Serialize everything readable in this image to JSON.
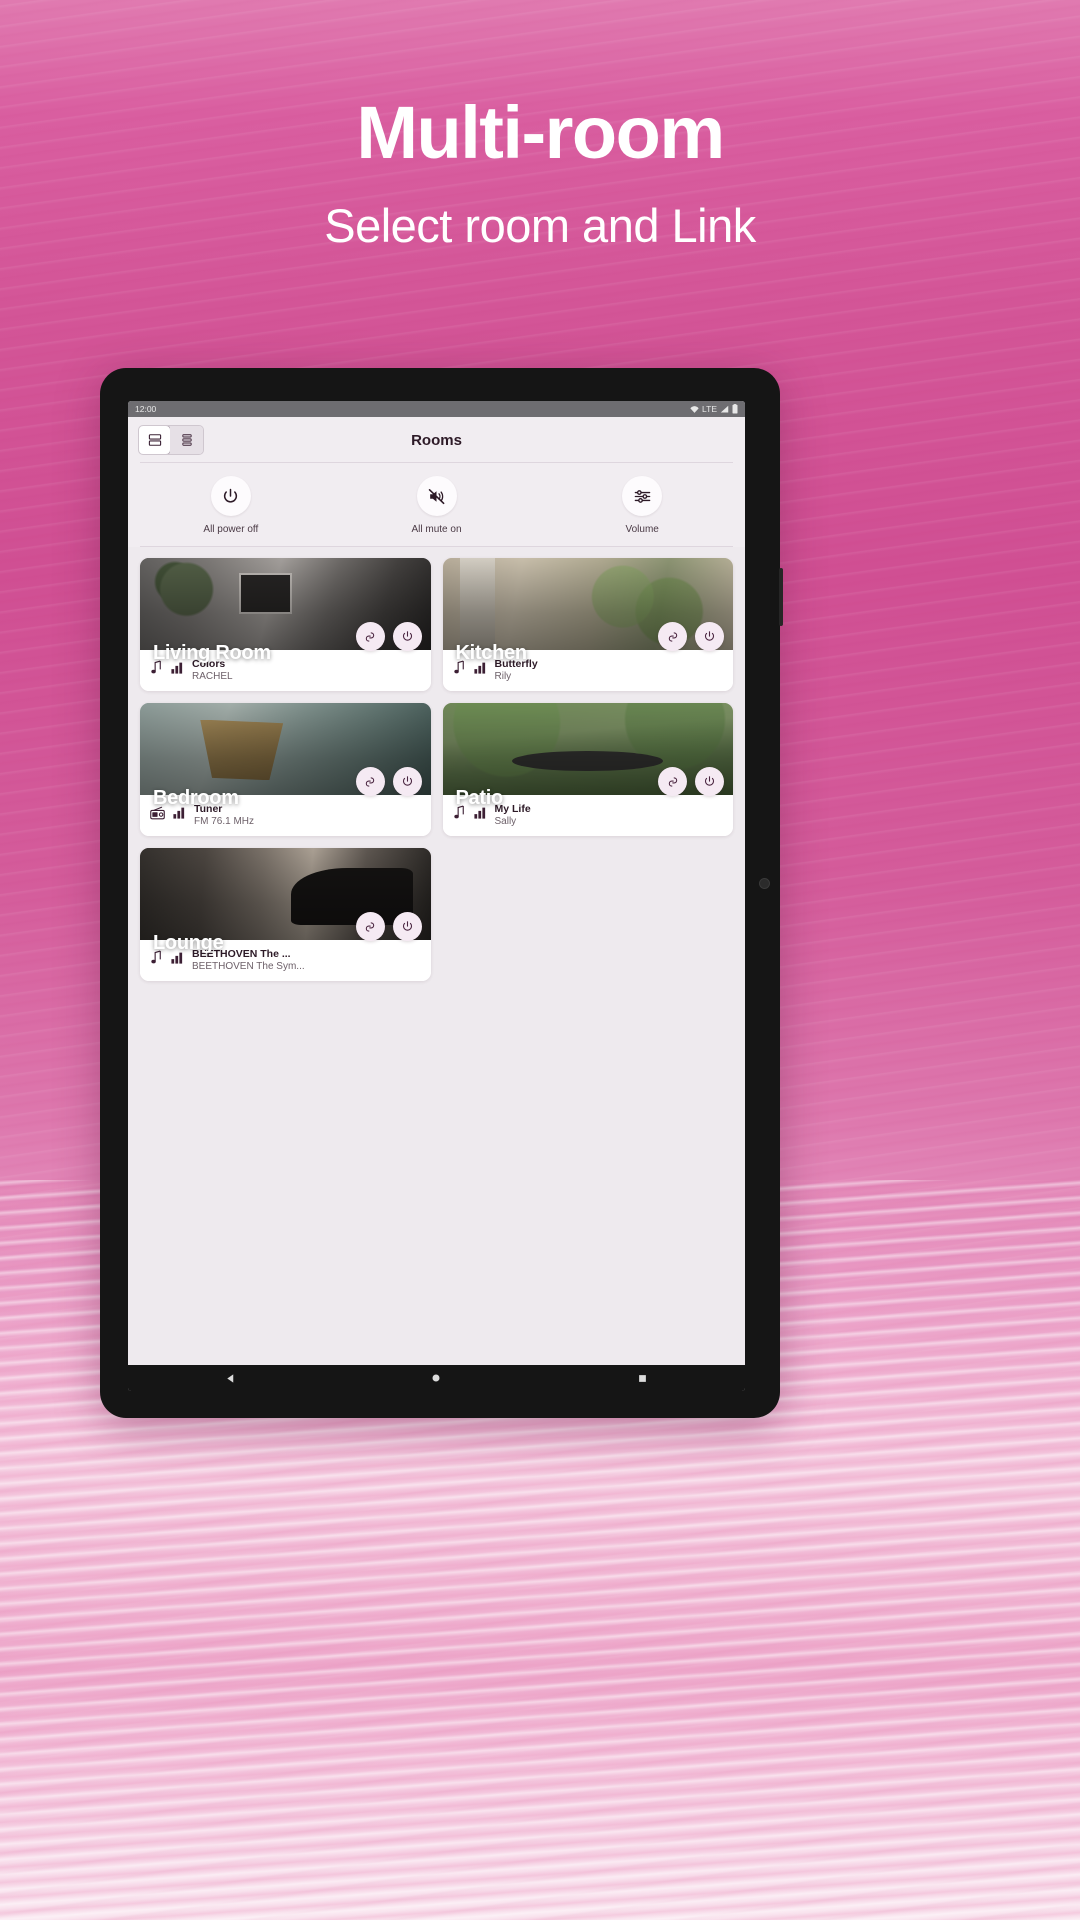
{
  "promo": {
    "title": "Multi-room",
    "subtitle": "Select room and Link",
    "title_color": "#ffffff",
    "background_accent": "#d0529a"
  },
  "status_bar": {
    "time": "12:00",
    "network_label": "LTE",
    "icons": [
      "wifi-icon",
      "signal-icon",
      "battery-icon"
    ]
  },
  "app_bar": {
    "title": "Rooms",
    "view_toggle": {
      "options": [
        "grid-view",
        "list-view"
      ],
      "selected": "grid-view"
    }
  },
  "quick_actions": [
    {
      "icon": "power-icon",
      "label": "All power off"
    },
    {
      "icon": "mute-icon",
      "label": "All mute on"
    },
    {
      "icon": "sliders-icon",
      "label": "Volume"
    }
  ],
  "rooms": [
    {
      "name": "Living Room",
      "photo": "living-room-photo",
      "source_icon": "music-note-icon",
      "level_icon": "signal-bars-icon",
      "track_title": "Colors",
      "track_subtitle": "RACHEL",
      "link_button": "link-icon",
      "power_button": "power-icon"
    },
    {
      "name": "Kitchen",
      "photo": "kitchen-photo",
      "source_icon": "music-note-icon",
      "level_icon": "signal-bars-icon",
      "track_title": "Butterfly",
      "track_subtitle": "Rily",
      "link_button": "link-icon",
      "power_button": "power-icon"
    },
    {
      "name": "Bedroom",
      "photo": "bedroom-photo",
      "source_icon": "radio-icon",
      "level_icon": "signal-bars-icon",
      "track_title": "Tuner",
      "track_subtitle": "FM 76.1 MHz",
      "link_button": "link-icon",
      "power_button": "power-icon"
    },
    {
      "name": "Patio",
      "photo": "patio-photo",
      "source_icon": "music-note-icon",
      "level_icon": "signal-bars-icon",
      "track_title": "My Life",
      "track_subtitle": "Sally",
      "link_button": "link-icon",
      "power_button": "power-icon"
    },
    {
      "name": "Lounge",
      "photo": "lounge-photo",
      "source_icon": "music-note-icon",
      "level_icon": "signal-bars-icon",
      "track_title": "BEETHOVEN The ...",
      "track_subtitle": "BEETHOVEN The Sym...",
      "link_button": "link-icon",
      "power_button": "power-icon"
    }
  ],
  "nav_bar": {
    "back": "back-triangle-icon",
    "home": "home-circle-icon",
    "recents": "recents-square-icon"
  }
}
